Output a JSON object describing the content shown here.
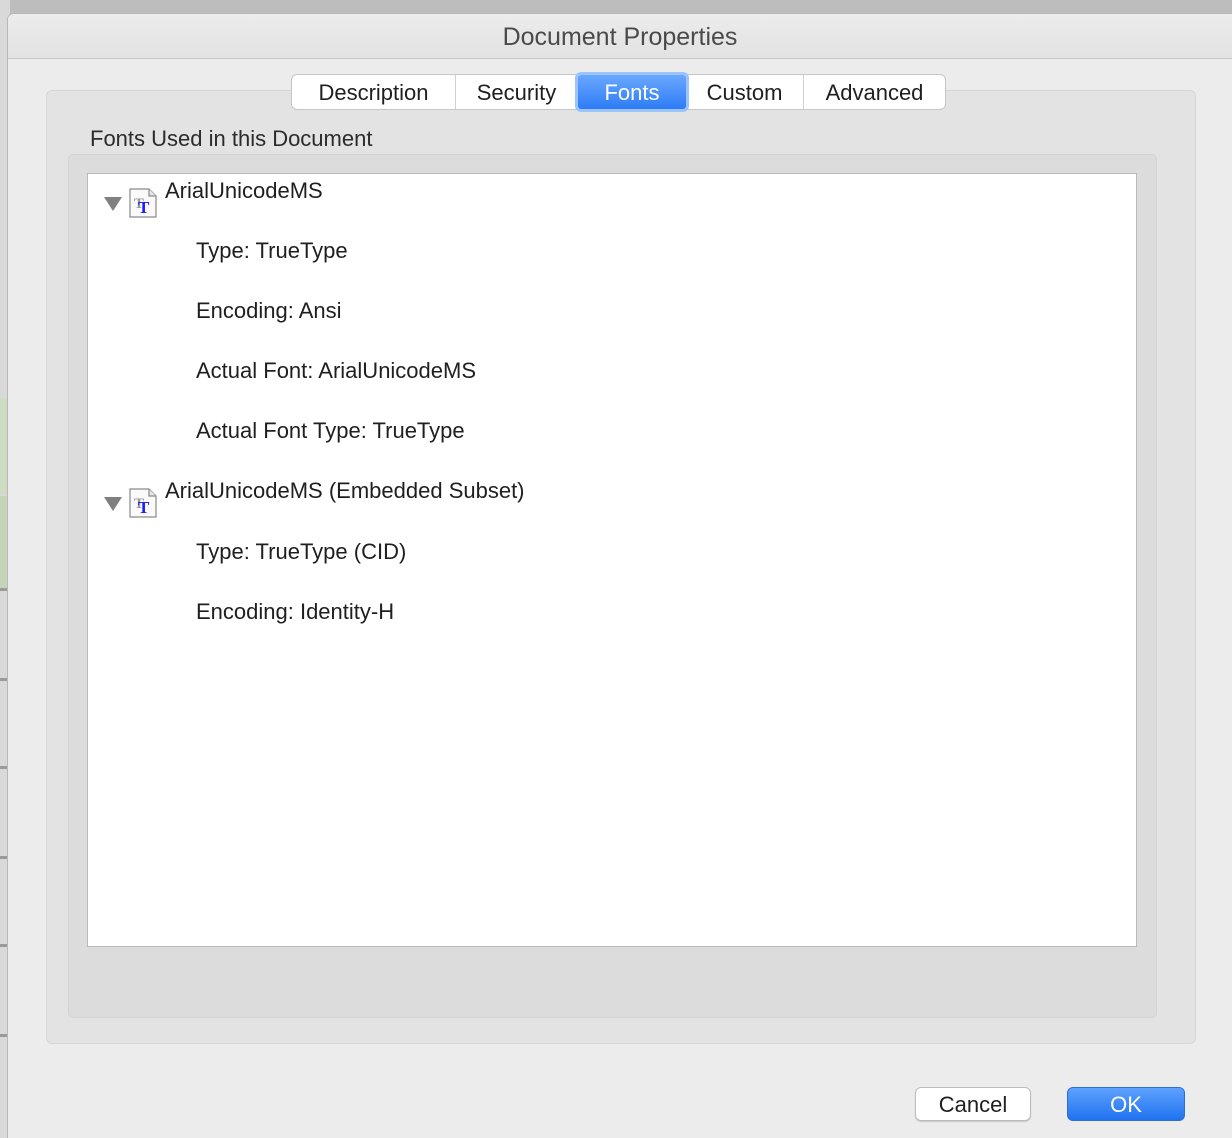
{
  "window": {
    "title": "Document Properties"
  },
  "tabs": [
    {
      "label": "Description",
      "active": false
    },
    {
      "label": "Security",
      "active": false
    },
    {
      "label": "Fonts",
      "active": true
    },
    {
      "label": "Custom",
      "active": false
    },
    {
      "label": "Advanced",
      "active": false
    }
  ],
  "fonts_section": {
    "label": "Fonts Used in this Document",
    "fonts": [
      {
        "name": "ArialUnicodeMS",
        "icon": "truetype-font-icon",
        "expanded": true,
        "properties": [
          "Type: TrueType",
          "Encoding: Ansi",
          "Actual Font: ArialUnicodeMS",
          "Actual Font Type: TrueType"
        ]
      },
      {
        "name": "ArialUnicodeMS (Embedded Subset)",
        "icon": "truetype-font-icon",
        "expanded": true,
        "properties": [
          "Type: TrueType (CID)",
          "Encoding: Identity-H"
        ]
      }
    ]
  },
  "buttons": {
    "cancel": "Cancel",
    "ok": "OK"
  },
  "colors": {
    "accent": "#2d7cf6",
    "panel": "#e3e3e3",
    "icon_letter": "#1a1aff"
  }
}
